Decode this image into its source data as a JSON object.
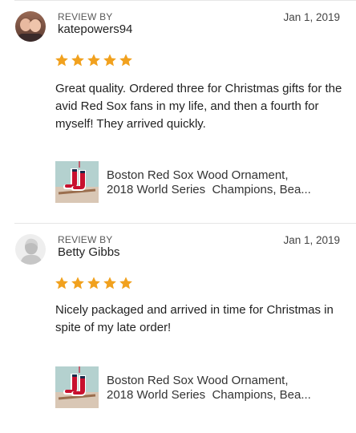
{
  "reviews": [
    {
      "review_by_label": "REVIEW BY",
      "reviewer": "katepowers94",
      "date": "Jan 1, 2019",
      "rating": 5,
      "text": "Great quality. Ordered three for Christmas gifts for the avid Red Sox fans in my life, and then a fourth for myself! They arrived quickly.",
      "product": {
        "title_line1": "Boston Red Sox Wood Ornament,",
        "title_line2": "2018 World Series  Champions, Bea..."
      },
      "avatar": "photo-avatar"
    },
    {
      "review_by_label": "REVIEW BY",
      "reviewer": "Betty Gibbs",
      "date": "Jan 1, 2019",
      "rating": 5,
      "text": "Nicely packaged and arrived in time for Christmas in spite of my late order!",
      "product": {
        "title_line1": "Boston Red Sox Wood Ornament,",
        "title_line2": "2018 World Series  Champions, Bea..."
      },
      "avatar": "default-user-avatar"
    }
  ],
  "colors": {
    "star": "#F1A11E",
    "divider": "#E6E6E6",
    "muted_text": "#595959",
    "sock_red": "#C8102E"
  },
  "icons": [
    "star-icon",
    "user-silhouette-icon"
  ]
}
